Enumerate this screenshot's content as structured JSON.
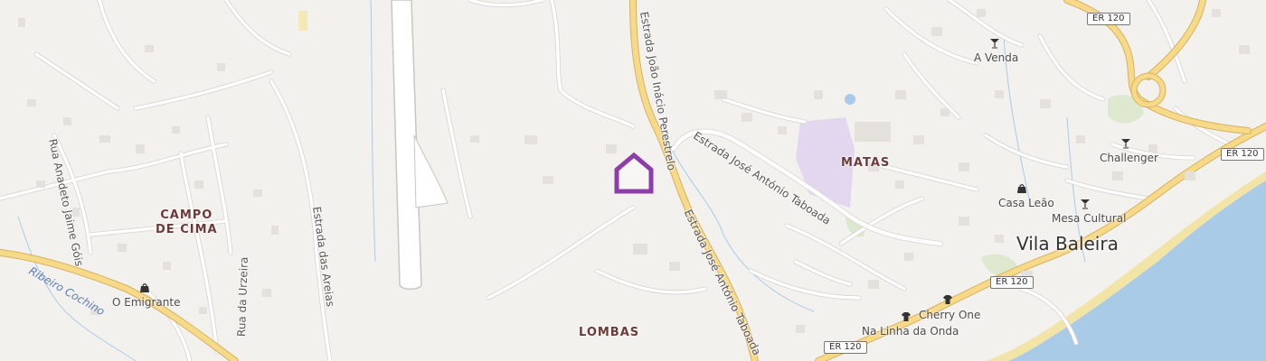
{
  "places": {
    "campo_de_cima": "CAMPO\nDE CIMA",
    "matas": "MATAS",
    "lombas": "LOMBAS",
    "vila_baleira": "Vila Baleira"
  },
  "roads": {
    "estrada_joao_inacio": "Estrada João Inácio Perestrelo",
    "estrada_jose_antonio_1": "Estrada José António Taboada",
    "estrada_jose_antonio_2": "Estrada José António Taboada",
    "rua_anadeto": "Rua Anadeto Jaime Góis",
    "estrada_das_areias": "Estrada das Areias",
    "rua_da_urzeira": "Rua da Urzeira",
    "ribeiro_cochino": "Ribeiro Cochino"
  },
  "shields": {
    "er120_a": "ER 120",
    "er120_b": "ER 120",
    "er120_c": "ER 120",
    "er120_d": "ER 120"
  },
  "pois": {
    "a_venda": "A Venda",
    "challenger": "Challenger",
    "casa_leao": "Casa Leão",
    "mesa_cultural": "Mesa Cultural",
    "o_emigrante": "O Emigrante",
    "cherry_one": "Cherry One",
    "na_linha_da_onda": "Na Linha da Onda"
  },
  "icons": {
    "bar": "cocktail-glass-icon",
    "shop": "shopping-bag-icon",
    "clothes": "t-shirt-icon",
    "location": "house-marker-icon"
  },
  "colors": {
    "land": "#f3f1ee",
    "sea": "#a9cbe8",
    "beach": "#f2e3a6",
    "highway": "#f7d98a",
    "highway_casing": "#d7b25e",
    "marker": "#8e3ea8",
    "place_label": "#6b3a3a",
    "industrial": "#e3d6ef"
  }
}
